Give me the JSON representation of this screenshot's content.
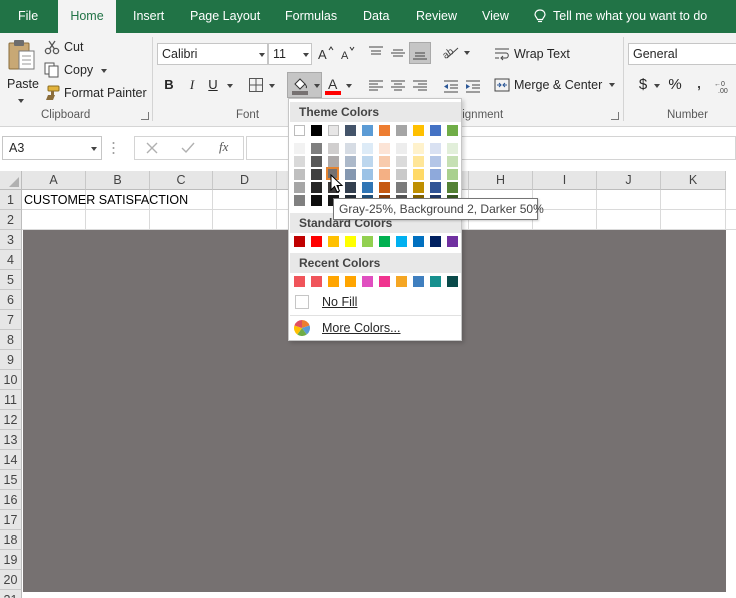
{
  "tabs": [
    {
      "label": "File",
      "active": false
    },
    {
      "label": "Home",
      "active": true
    },
    {
      "label": "Insert",
      "active": false
    },
    {
      "label": "Page Layout",
      "active": false
    },
    {
      "label": "Formulas",
      "active": false
    },
    {
      "label": "Data",
      "active": false
    },
    {
      "label": "Review",
      "active": false
    },
    {
      "label": "View",
      "active": false
    }
  ],
  "tell_me": "Tell me what you want to do",
  "ribbon": {
    "clipboard": {
      "paste": "Paste",
      "cut": "Cut",
      "copy": "Copy",
      "format_painter": "Format Painter",
      "group_label": "Clipboard"
    },
    "font": {
      "font_name": "Calibri",
      "font_size": "11",
      "bold": "B",
      "italic": "I",
      "underline": "U",
      "group_label": "Font"
    },
    "alignment": {
      "wrap_text": "Wrap Text",
      "merge_center": "Merge & Center",
      "group_label": "Alignment"
    },
    "number": {
      "format": "General",
      "dollar": "$",
      "percent": "%",
      "comma": ",",
      "group_label": "Number"
    }
  },
  "formula_bar": {
    "name_box": "A3",
    "fx": "fx",
    "formula": ""
  },
  "grid": {
    "columns": [
      "A",
      "B",
      "C",
      "D",
      "E",
      "F",
      "G",
      "H",
      "I",
      "J",
      "K"
    ],
    "rows": [
      "1",
      "2",
      "3",
      "4",
      "5",
      "6",
      "7",
      "8",
      "9",
      "10",
      "11",
      "12",
      "13",
      "14",
      "15",
      "16",
      "17",
      "18",
      "19",
      "20",
      "21"
    ],
    "cell_A1": "CUSTOMER SATISFACTION",
    "fill_color": "#767171"
  },
  "color_menu": {
    "theme_header": "Theme Colors",
    "standard_header": "Standard Colors",
    "recent_header": "Recent Colors",
    "no_fill": "No Fill",
    "more_colors": "More Colors...",
    "theme_top": [
      "#FFFFFF",
      "#000000",
      "#E7E6E6",
      "#44546A",
      "#5B9BD5",
      "#ED7D31",
      "#A5A5A5",
      "#FFC000",
      "#4472C4",
      "#70AD47"
    ],
    "theme_shades": [
      [
        "#F2F2F2",
        "#7F7F7F",
        "#D0CECE",
        "#D6DCE4",
        "#DDEBF7",
        "#FCE4D6",
        "#EDEDED",
        "#FFF2CC",
        "#D9E1F2",
        "#E2EFDA"
      ],
      [
        "#D9D9D9",
        "#595959",
        "#AEAAAA",
        "#ACB9CA",
        "#BDD7EE",
        "#F8CBAD",
        "#DBDBDB",
        "#FFE699",
        "#B4C6E7",
        "#C6E0B4"
      ],
      [
        "#BFBFBF",
        "#404040",
        "#757171",
        "#8497B0",
        "#9BC2E6",
        "#F4B084",
        "#C9C9C9",
        "#FFD966",
        "#8EA9DB",
        "#A9D08E"
      ],
      [
        "#A6A6A6",
        "#262626",
        "#3A3838",
        "#333F4F",
        "#2F75B5",
        "#C65911",
        "#7B7B7B",
        "#BF8F00",
        "#305496",
        "#548235"
      ],
      [
        "#808080",
        "#0D0D0D",
        "#161616",
        "#222B35",
        "#1F4E78",
        "#833C0C",
        "#525252",
        "#806000",
        "#203764",
        "#375623"
      ]
    ],
    "standard": [
      "#C00000",
      "#FF0000",
      "#FFC000",
      "#FFFF00",
      "#92D050",
      "#00B050",
      "#00B0F0",
      "#0070C0",
      "#002060",
      "#7030A0"
    ],
    "recent": [
      "#F0545A",
      "#F0545A",
      "#FFA500",
      "#FFA500",
      "#E04FC0",
      "#F0348F",
      "#F5A623",
      "#3F7FBF",
      "#17908E",
      "#0A4A4A"
    ]
  },
  "tooltip": "Gray-25%, Background 2, Darker 50%"
}
